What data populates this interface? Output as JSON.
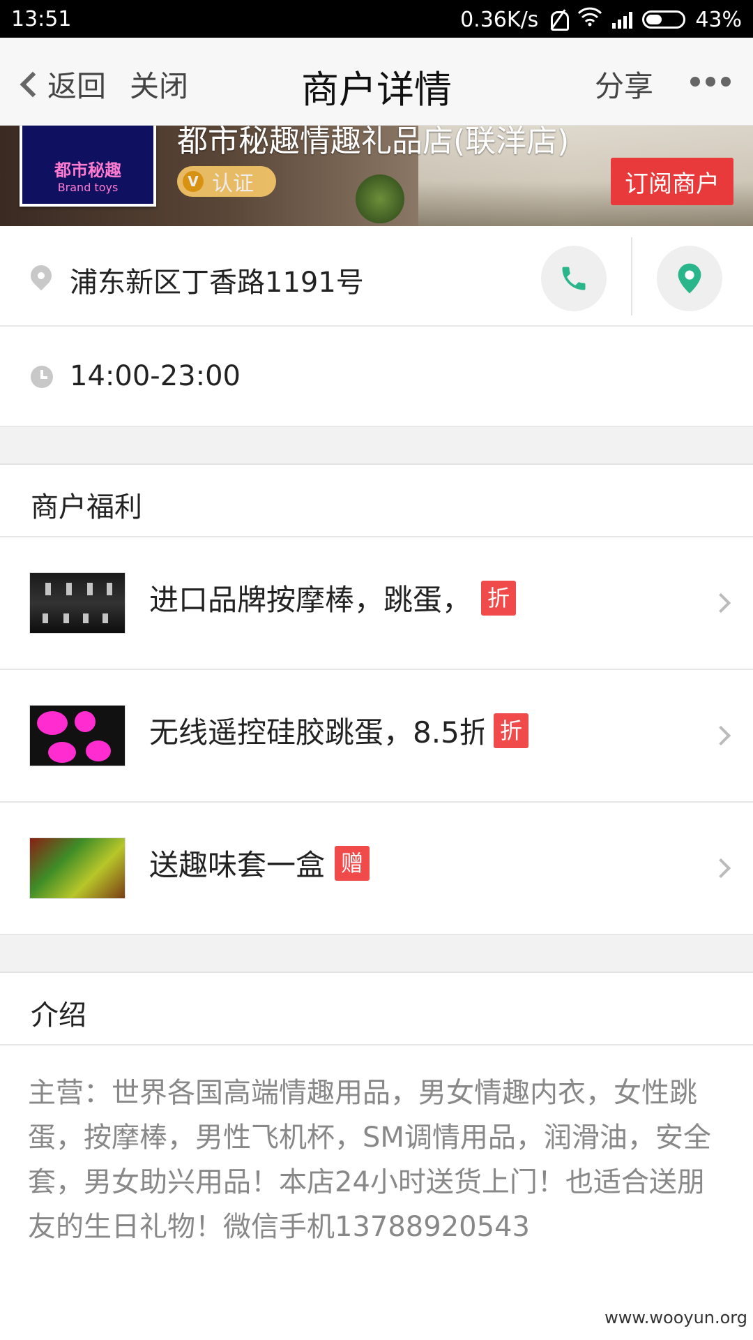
{
  "status_bar": {
    "time": "13:51",
    "network_speed": "0.36K/s",
    "battery_percent": "43%",
    "battery_level": 0.43,
    "icons": [
      "mute-bell-icon",
      "wifi-icon",
      "signal-icon",
      "battery-icon"
    ]
  },
  "nav": {
    "back_label": "返回",
    "close_label": "关闭",
    "title": "商户详情",
    "share_label": "分享",
    "more_icon": "more-dots-icon"
  },
  "merchant": {
    "name": "都市秘趣情趣礼品店(联洋店)",
    "logo_text": "都市秘趣",
    "logo_subtext": "Brand toys",
    "verified_badge_letter": "V",
    "verified_label": "认证",
    "subscribe_label": "订阅商户",
    "address": "浦东新区丁香路1191号",
    "hours": "14:00-23:00"
  },
  "colors": {
    "accent_green": "#2bb58a",
    "subscribe_red": "#e8393b",
    "tag_red": "#f04a4a",
    "verify_gold": "#f7c869"
  },
  "benefits": {
    "heading": "商户福利",
    "items": [
      {
        "label": "进口品牌按摩棒，跳蛋，",
        "tag": "折"
      },
      {
        "label": "无线遥控硅胶跳蛋，8.5折",
        "tag": "折"
      },
      {
        "label": "送趣味套一盒",
        "tag": "赠"
      }
    ]
  },
  "intro": {
    "heading": "介绍",
    "text": "主营：世界各国高端情趣用品，男女情趣内衣，女性跳蛋，按摩棒，男性飞机杯，SM调情用品，润滑油，安全套，男女助兴用品！本店24小时送货上门！也适合送朋友的生日礼物！微信手机13788920543"
  },
  "watermark": "www.wooyun.org"
}
